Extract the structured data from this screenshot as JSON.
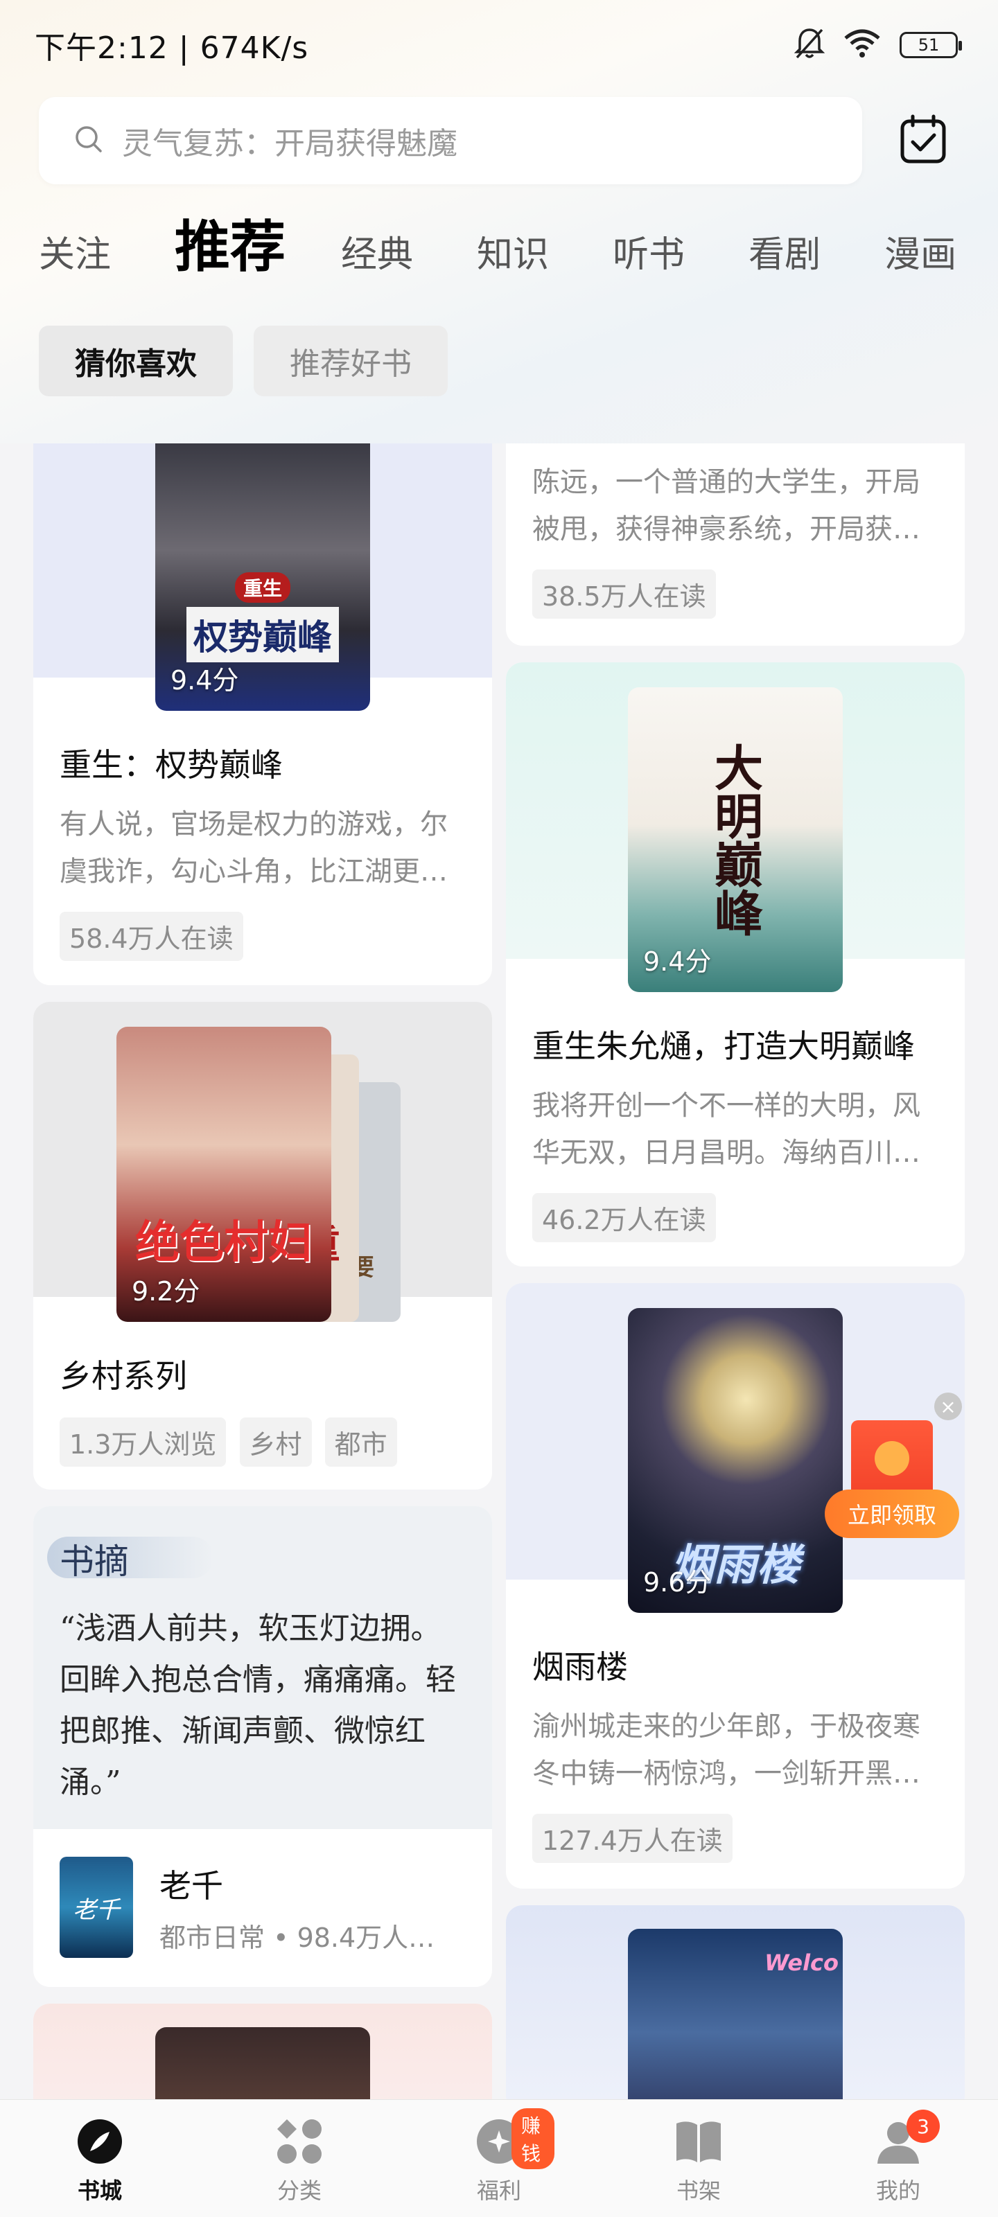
{
  "status_bar": {
    "time": "下午2:12 | 674K/s",
    "battery": "51"
  },
  "search": {
    "placeholder": "灵气复苏：开局获得魅魔"
  },
  "tabs": [
    {
      "label": "关注",
      "active": false
    },
    {
      "label": "推荐",
      "active": true
    },
    {
      "label": "经典",
      "active": false
    },
    {
      "label": "知识",
      "active": false
    },
    {
      "label": "听书",
      "active": false
    },
    {
      "label": "看剧",
      "active": false
    },
    {
      "label": "漫画",
      "active": false
    }
  ],
  "chips": [
    {
      "label": "猜你喜欢",
      "active": true
    },
    {
      "label": "推荐好书",
      "active": false
    }
  ],
  "left_column": {
    "card1": {
      "cover_text": "权势巅峰",
      "cover_tag": "重生",
      "score": "9.4分",
      "title": "重生：权势巅峰",
      "desc": "有人说，官场是权力的游戏，尔虞我诈，勾心斗角，比江湖更…",
      "readers": "58.4万人在读"
    },
    "card2": {
      "cover_text": "绝色村妇",
      "cover2_text": "重",
      "cover3_text": "要",
      "score": "9.2分",
      "title": "乡村系列",
      "tags": [
        "1.3万人浏览",
        "乡村",
        "都市"
      ]
    },
    "card3": {
      "label": "书摘",
      "quote": "“浅酒人前共，软玉灯边拥。回眸入抱总合情，痛痛痛。轻把郎推、渐闻声颤、微惊红涌。”",
      "thumb_text": "老千",
      "book_title": "老千",
      "book_meta": "都市日常 • 98.4万人…"
    }
  },
  "right_column": {
    "card1": {
      "desc": "陈远，一个普通的大学生，开局被甩，获得神豪系统，开局获…",
      "readers": "38.5万人在读"
    },
    "card2": {
      "cover_text": "大明巅峰",
      "score": "9.4分",
      "title": "重生朱允熥，打造大明巅峰",
      "desc": "我将开创一个不一样的大明，风华无双，日月昌明。海纳百川…",
      "readers": "46.2万人在读"
    },
    "card3": {
      "cover_text": "烟雨楼",
      "score": "9.6分",
      "title": "烟雨楼",
      "desc": "渝州城走来的少年郎，于极夜寒冬中铸一柄惊鸿，一剑斩开黑…",
      "readers": "127.4万人在读"
    },
    "card4": {
      "cover_text": "Welco"
    }
  },
  "promo": {
    "close": "×",
    "button": "立即领取"
  },
  "bottom_nav": [
    {
      "label": "书城",
      "icon": "compass-icon",
      "active": true
    },
    {
      "label": "分类",
      "icon": "grid-icon",
      "active": false
    },
    {
      "label": "福利",
      "icon": "gift-icon",
      "active": false,
      "badge": "赚钱"
    },
    {
      "label": "书架",
      "icon": "book-icon",
      "active": false
    },
    {
      "label": "我的",
      "icon": "user-icon",
      "active": false,
      "badge": "3"
    }
  ],
  "colors": {
    "accent": "#ff5a2a",
    "text_primary": "#111111",
    "text_secondary": "#8c8c8c"
  }
}
